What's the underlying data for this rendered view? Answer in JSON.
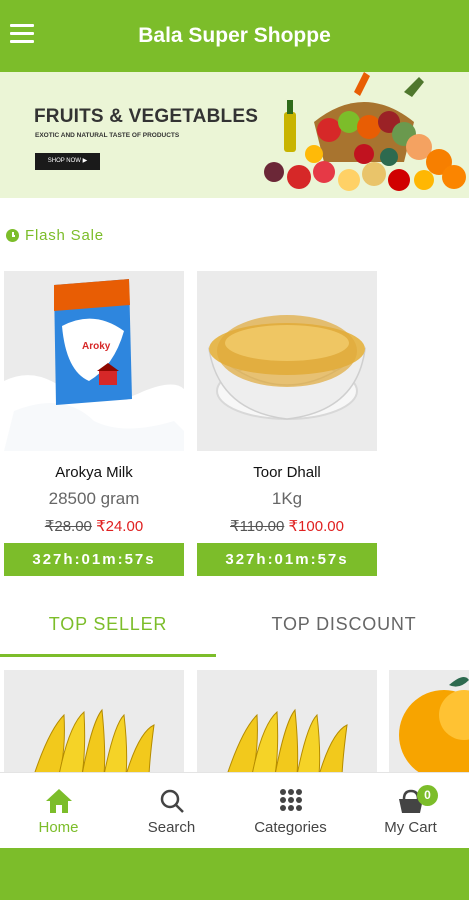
{
  "app": {
    "title": "Bala Super Shoppe"
  },
  "banner": {
    "title": "FRUITS & VEGETABLES",
    "subtitle": "EXOTIC AND NATURAL TASTE OF PRODUCTS",
    "cta": "SHOP NOW ▶",
    "slide_count": 3,
    "active_slide": 2
  },
  "flash_sale": {
    "heading": "Flash Sale",
    "products": [
      {
        "name": "Arokya Milk",
        "quantity": "28500 gram",
        "old_price": "₹28.00",
        "new_price": "₹24.00",
        "timer": "327h:01m:57s"
      },
      {
        "name": "Toor Dhall",
        "quantity": "1Kg",
        "old_price": "₹110.00",
        "new_price": "₹100.00",
        "timer": "327h:01m:57s"
      }
    ]
  },
  "tabs": [
    {
      "label": "TOP SELLER",
      "active": true
    },
    {
      "label": "TOP DISCOUNT",
      "active": false
    }
  ],
  "bottom_nav": [
    {
      "label": "Home",
      "icon": "home-icon",
      "active": true
    },
    {
      "label": "Search",
      "icon": "search-icon",
      "active": false
    },
    {
      "label": "Categories",
      "icon": "grid-icon",
      "active": false
    },
    {
      "label": "My Cart",
      "icon": "cart-icon",
      "active": false,
      "badge": "0"
    }
  ],
  "colors": {
    "accent": "#7cbd2a",
    "sale_price": "#e02020",
    "card_bg": "#ebebeb"
  }
}
